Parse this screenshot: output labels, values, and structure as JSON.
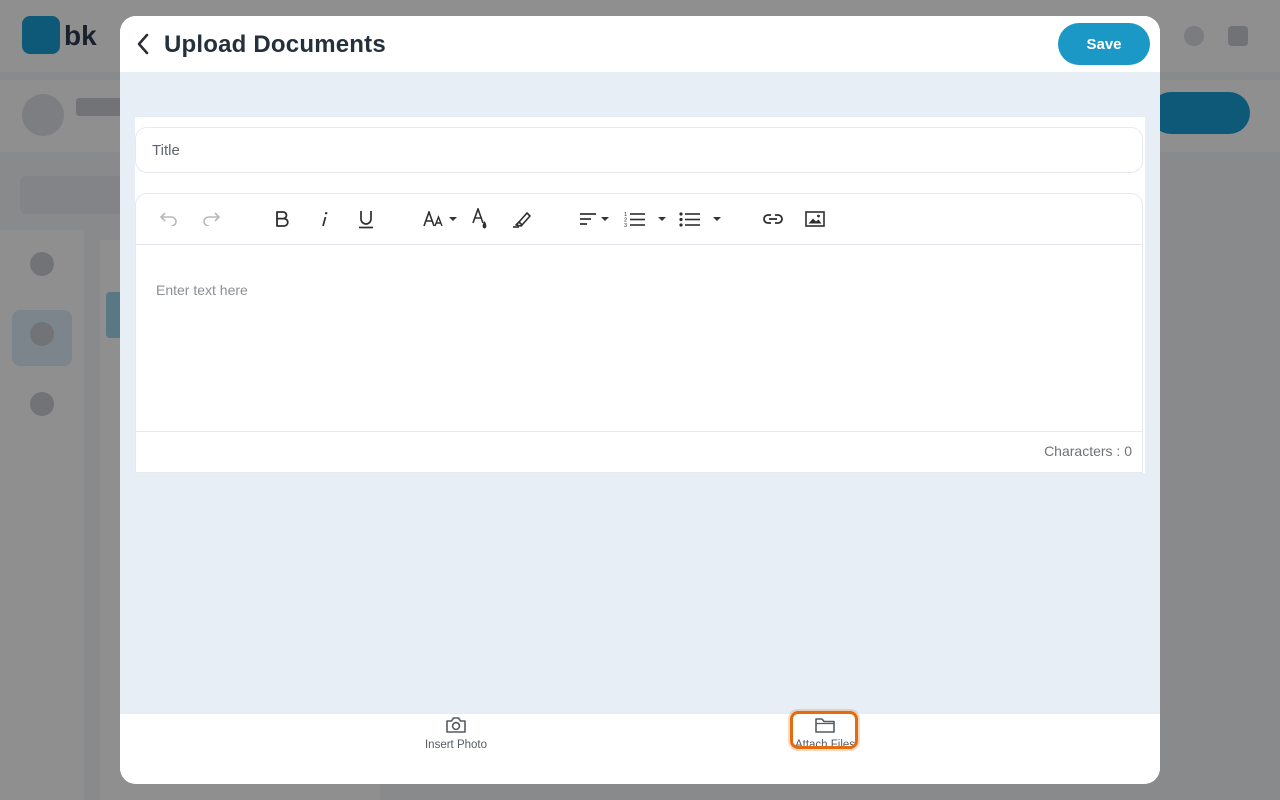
{
  "background": {
    "logo_text": "bk"
  },
  "modal": {
    "title": "Upload Documents",
    "save_label": "Save",
    "title_placeholder": "Title",
    "editor": {
      "placeholder": "Enter text here",
      "char_count_label": "Characters : ",
      "char_count_value": "0",
      "toolbar": [
        "undo-icon",
        "redo-icon",
        "bold-icon",
        "italic-icon",
        "underline-icon",
        "font-size-icon",
        "text-color-icon",
        "highlight-icon",
        "align-icon",
        "numbered-list-icon",
        "bullet-list-icon",
        "link-icon",
        "image-icon"
      ]
    },
    "bottom": {
      "insert_photo_label": "Insert Photo",
      "attach_files_label": "Attach Files"
    }
  },
  "colors": {
    "accent": "#1c98c7",
    "focus_ring": "#e36b10",
    "modal_bg": "#e8eef6"
  }
}
